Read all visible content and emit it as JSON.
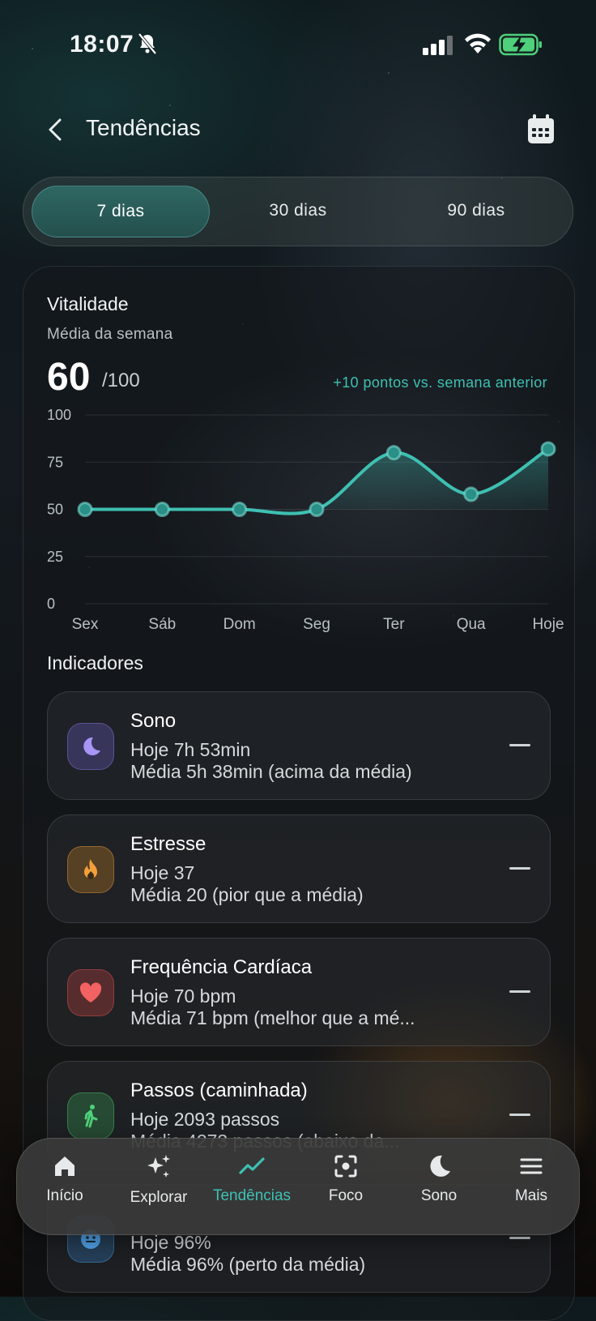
{
  "status_bar": {
    "time": "18:07"
  },
  "header": {
    "title": "Tendências"
  },
  "range_tabs": [
    {
      "label": "7 dias",
      "active": true
    },
    {
      "label": "30 dias",
      "active": false
    },
    {
      "label": "90 dias",
      "active": false
    }
  ],
  "vitality": {
    "title": "Vitalidade",
    "subtitle": "Média da semana",
    "score": "60",
    "score_max": "/100",
    "delta": "+10 pontos vs. semana anterior"
  },
  "chart_data": {
    "type": "line",
    "categories": [
      "Sex",
      "Sáb",
      "Dom",
      "Seg",
      "Ter",
      "Qua",
      "Hoje"
    ],
    "series": [
      {
        "values": [
          50,
          50,
          50,
          50,
          80,
          58,
          82
        ]
      }
    ],
    "ylim": [
      0,
      100
    ],
    "yticks": [
      "100",
      "75",
      "50",
      "25",
      "0"
    ],
    "grid": true,
    "color": "#3ec0b2"
  },
  "indicators_title": "Indicadores",
  "indicators": [
    {
      "name": "Sono",
      "today": "Hoje 7h 53min",
      "avg": "Média 5h 38min (acima da média)",
      "icon": "moon-icon",
      "color": "#9f8ff0"
    },
    {
      "name": "Estresse",
      "today": "Hoje 37",
      "avg": "Média 20 (pior que a média)",
      "icon": "flame-icon",
      "color": "#f0a040"
    },
    {
      "name": "Frequência Cardíaca",
      "today": "Hoje 70 bpm",
      "avg": "Média 71 bpm (melhor que a mé...",
      "icon": "heart-icon",
      "color": "#f05b5b"
    },
    {
      "name": "Passos (caminhada)",
      "today": "Hoje 2093 passos",
      "avg": "Média 4273 passos (abaixo da...",
      "icon": "walk-icon",
      "color": "#4fd07a"
    },
    {
      "name": "",
      "today": "Hoje 96%",
      "avg": "Média 96% (perto da média)",
      "icon": "face-icon",
      "color": "#52a8f0"
    }
  ],
  "nav": [
    {
      "label": "Início",
      "icon": "home-icon",
      "active": false
    },
    {
      "label": "Explorar",
      "icon": "sparkle-icon",
      "active": false
    },
    {
      "label": "Tendências",
      "icon": "trend-icon",
      "active": true
    },
    {
      "label": "Foco",
      "icon": "focus-icon",
      "active": false
    },
    {
      "label": "Sono",
      "icon": "moon-icon",
      "active": false
    },
    {
      "label": "Mais",
      "icon": "menu-icon",
      "active": false
    }
  ]
}
